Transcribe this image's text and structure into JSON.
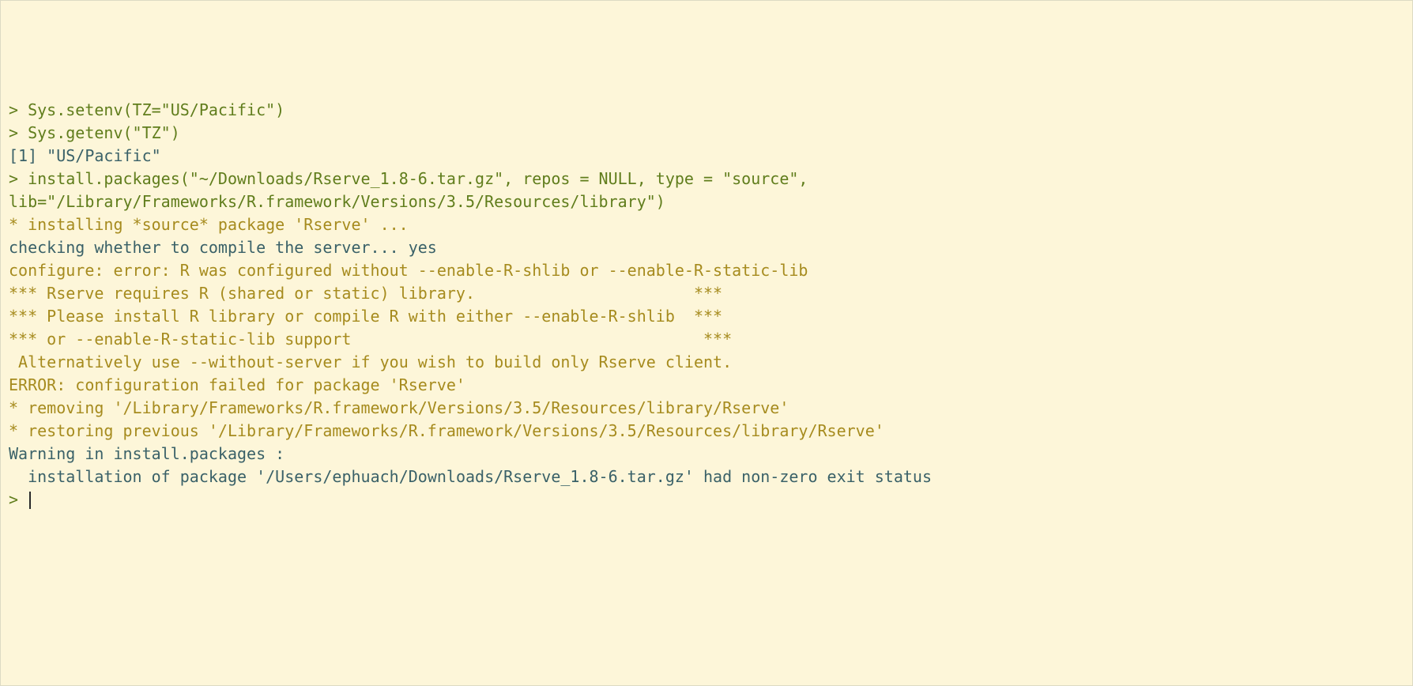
{
  "console": {
    "lines": [
      {
        "segments": [
          {
            "cls": "prompt",
            "text": "> "
          },
          {
            "cls": "input-code",
            "text": "Sys.setenv(TZ=\"US/Pacific\")"
          }
        ]
      },
      {
        "segments": [
          {
            "cls": "prompt",
            "text": "> "
          },
          {
            "cls": "input-code",
            "text": "Sys.getenv(\"TZ\")"
          }
        ]
      },
      {
        "segments": [
          {
            "cls": "output-plain",
            "text": "[1] \"US/Pacific\""
          }
        ]
      },
      {
        "segments": [
          {
            "cls": "prompt",
            "text": "> "
          },
          {
            "cls": "input-code",
            "text": "install.packages(\"~/Downloads/Rserve_1.8-6.tar.gz\", repos = NULL, type = \"source\", lib=\"/Library/Frameworks/R.framework/Versions/3.5/Resources/library\")"
          }
        ]
      },
      {
        "segments": [
          {
            "cls": "output-brown",
            "text": "* installing *source* package 'Rserve' ..."
          }
        ]
      },
      {
        "segments": [
          {
            "cls": "output-plain",
            "text": "checking whether to compile the server... yes"
          }
        ]
      },
      {
        "segments": [
          {
            "cls": "output-brown",
            "text": "configure: error: R was configured without --enable-R-shlib or --enable-R-static-lib"
          }
        ]
      },
      {
        "segments": [
          {
            "cls": "output-brown",
            "text": ""
          }
        ]
      },
      {
        "segments": [
          {
            "cls": "output-brown",
            "text": "*** Rserve requires R (shared or static) library.                       ***"
          }
        ]
      },
      {
        "segments": [
          {
            "cls": "output-brown",
            "text": "*** Please install R library or compile R with either --enable-R-shlib  ***"
          }
        ]
      },
      {
        "segments": [
          {
            "cls": "output-brown",
            "text": "*** or --enable-R-static-lib support                                     ***"
          }
        ]
      },
      {
        "segments": [
          {
            "cls": "output-brown",
            "text": ""
          }
        ]
      },
      {
        "segments": [
          {
            "cls": "output-brown",
            "text": " Alternatively use --without-server if you wish to build only Rserve client."
          }
        ]
      },
      {
        "segments": [
          {
            "cls": "output-brown",
            "text": ""
          }
        ]
      },
      {
        "segments": [
          {
            "cls": "output-brown",
            "text": ""
          }
        ]
      },
      {
        "segments": [
          {
            "cls": "output-brown",
            "text": "ERROR: configuration failed for package 'Rserve'"
          }
        ]
      },
      {
        "segments": [
          {
            "cls": "output-brown",
            "text": "* removing '/Library/Frameworks/R.framework/Versions/3.5/Resources/library/Rserve'"
          }
        ]
      },
      {
        "segments": [
          {
            "cls": "output-brown",
            "text": "* restoring previous '/Library/Frameworks/R.framework/Versions/3.5/Resources/library/Rserve'"
          }
        ]
      },
      {
        "segments": [
          {
            "cls": "output-plain",
            "text": "Warning in install.packages :"
          }
        ]
      },
      {
        "segments": [
          {
            "cls": "output-plain",
            "text": "  installation of package '/Users/ephuach/Downloads/Rserve_1.8-6.tar.gz' had non-zero exit status"
          }
        ]
      },
      {
        "segments": [
          {
            "cls": "prompt",
            "text": "> "
          }
        ],
        "cursor": true
      }
    ]
  }
}
